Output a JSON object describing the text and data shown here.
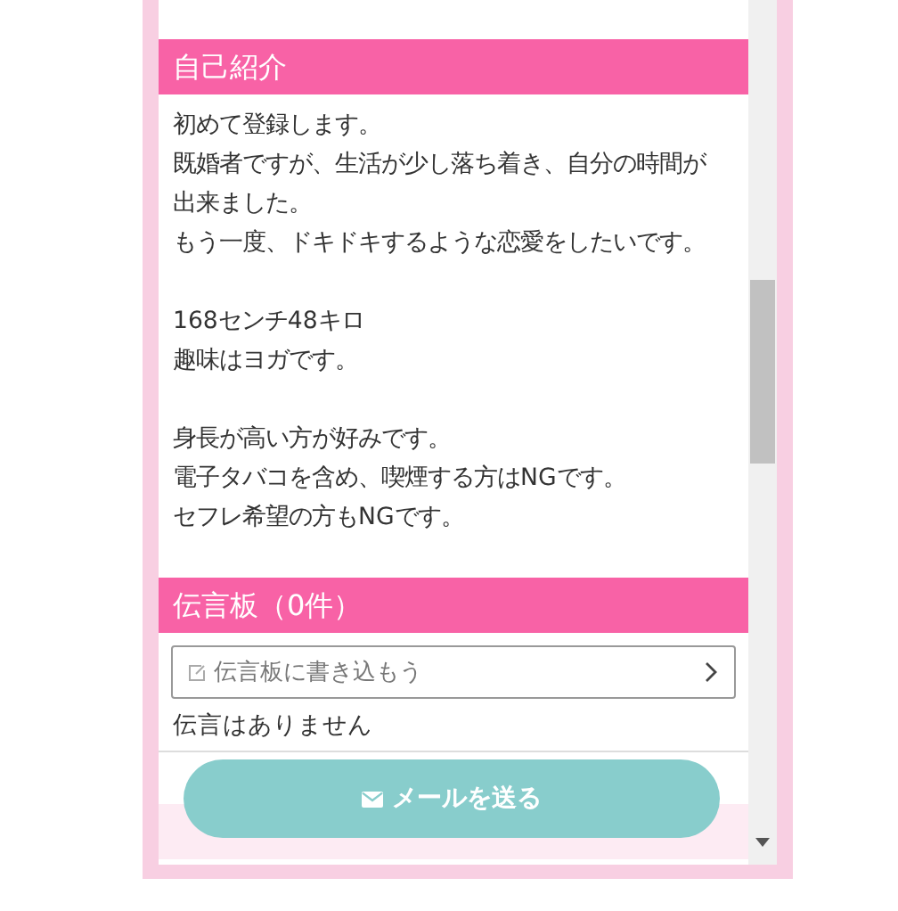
{
  "profile": {
    "heading": "自己紹介",
    "paragraphs": [
      [
        "初めて登録します。",
        "既婚者ですが、生活が少し落ち着き、自分の時間が出来ました。",
        "もう一度、ドキドキするような恋愛をしたいです。"
      ],
      [
        "168センチ48キロ",
        "趣味はヨガです。"
      ],
      [
        "身長が高い方が好みです。",
        "電子タバコを含め、喫煙する方はNGです。",
        "セフレ希望の方もNGです。"
      ]
    ]
  },
  "message_board": {
    "heading": "伝言板（0件）",
    "input": {
      "placeholder": "伝言板に書き込もう"
    },
    "empty_text": "伝言はありません"
  },
  "send_button": {
    "label": "メールを送る"
  }
}
